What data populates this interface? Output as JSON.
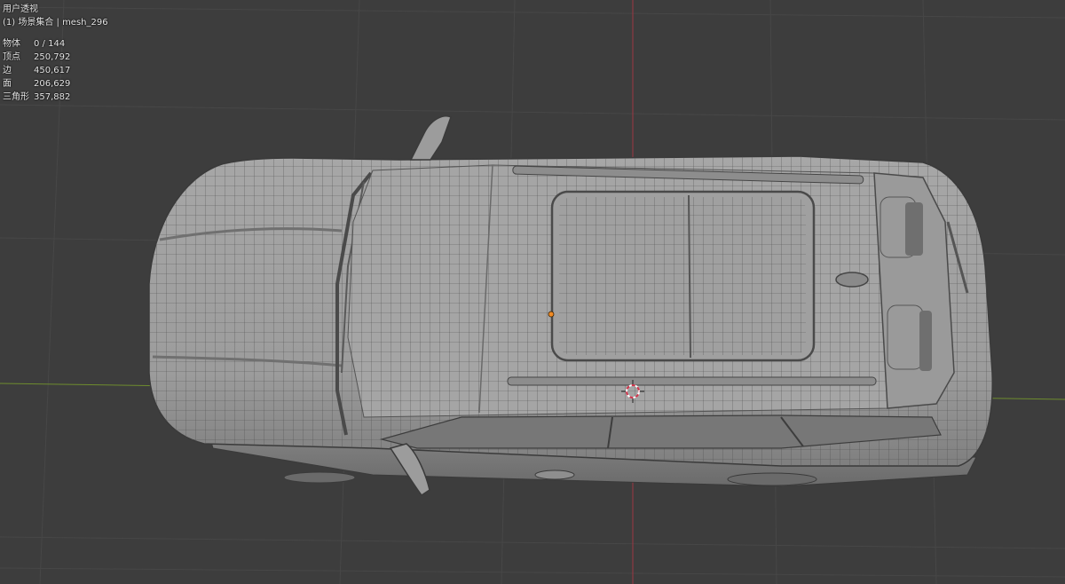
{
  "overlay": {
    "view_name": "用户透视",
    "collection_info": "(1) 场景集合 | mesh_296",
    "stats": [
      {
        "label": "物体",
        "value": "0 / 144"
      },
      {
        "label": "顶点",
        "value": "250,792"
      },
      {
        "label": "边",
        "value": "450,617"
      },
      {
        "label": "面",
        "value": "206,629"
      },
      {
        "label": "三角形",
        "value": "357,882"
      }
    ]
  },
  "viewport": {
    "background_color": "#3d3d3d",
    "grid_color": "#464646",
    "x_axis_color": "#9d3642",
    "y_axis_color": "#6e8c2e",
    "model_color": "#9a9a9a",
    "origin_marker_color": "#f08a24"
  }
}
